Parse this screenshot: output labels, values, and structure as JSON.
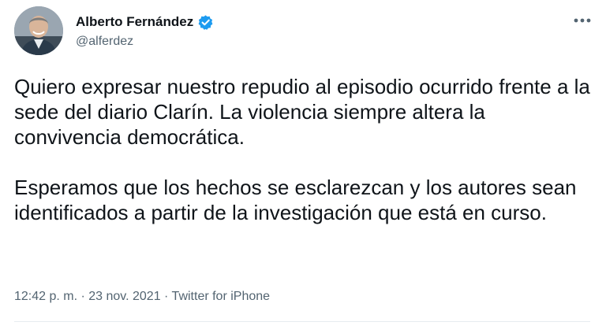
{
  "author": {
    "display_name": "Alberto Fernández",
    "handle": "@alferdez",
    "verified": true,
    "avatar_icon": "profile-photo"
  },
  "tweet": {
    "paragraphs": [
      "Quiero expresar nuestro repudio al episodio ocurrido frente a la sede del diario Clarín. La violencia siempre altera la convivencia democrática.",
      "Esperamos que los hechos se esclarezcan y los autores sean identificados a partir de la investigación que está en curso."
    ]
  },
  "meta": {
    "time": "12:42 p. m.",
    "separator1": " · ",
    "date": "23 nov. 2021",
    "separator2": " · ",
    "source": "Twitter for iPhone"
  },
  "icons": {
    "verified": "verified-badge-icon",
    "more": "more-options-icon"
  },
  "colors": {
    "verified_blue": "#1d9bf0",
    "secondary_text": "#536471",
    "primary_text": "#0f1419"
  }
}
